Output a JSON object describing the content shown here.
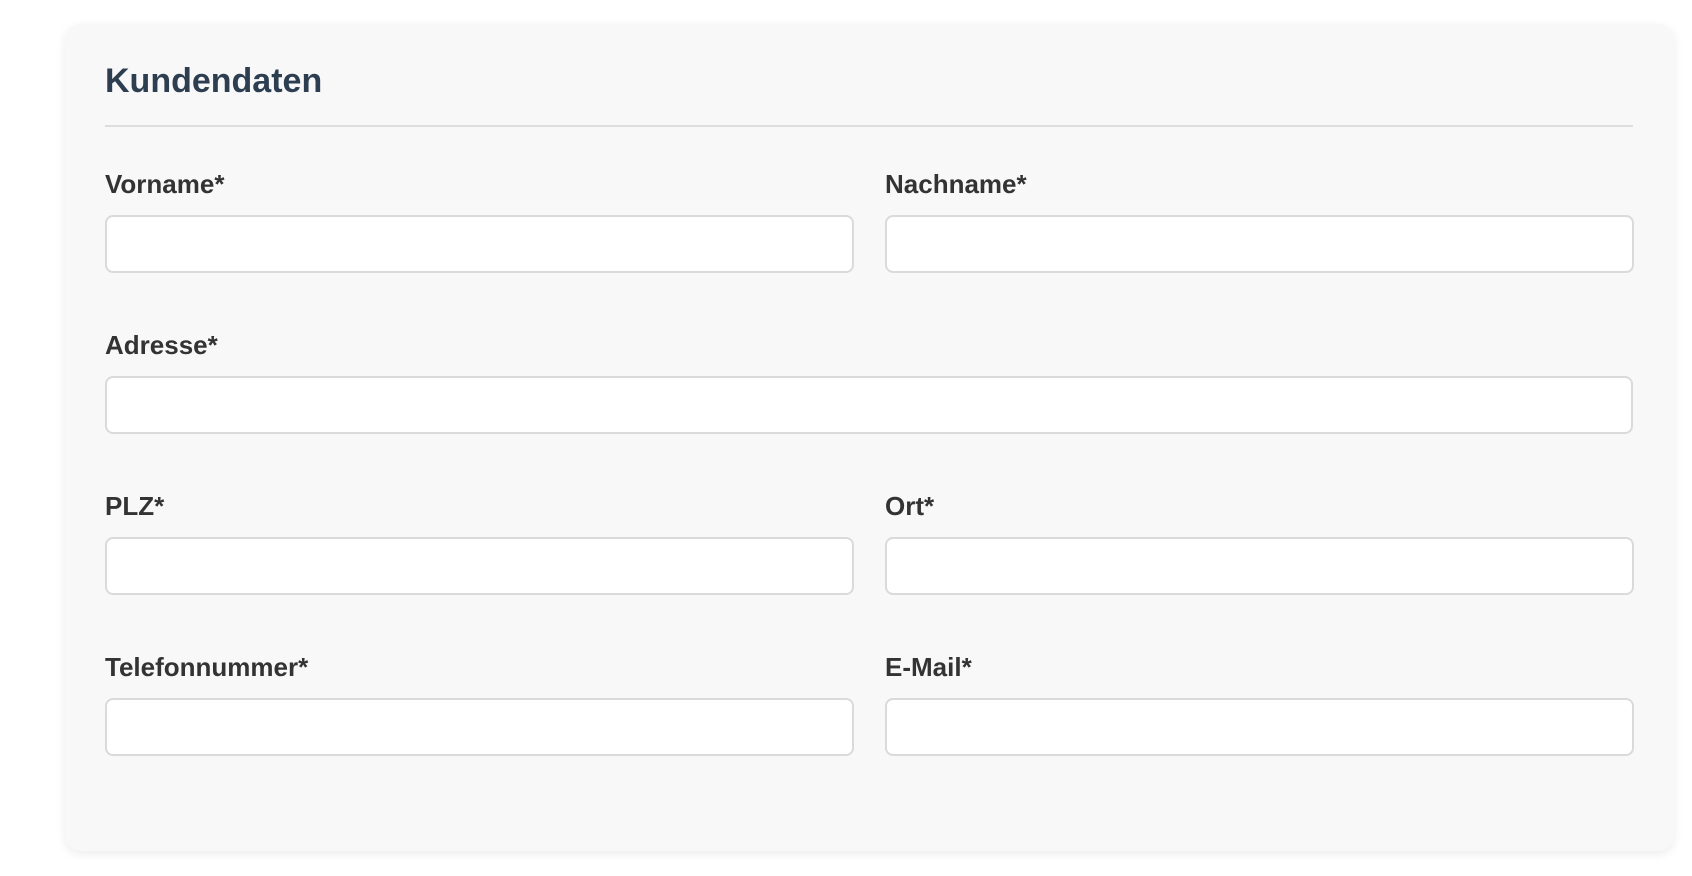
{
  "form": {
    "title": "Kundendaten",
    "fields": {
      "vorname": {
        "label": "Vorname*",
        "value": ""
      },
      "nachname": {
        "label": "Nachname*",
        "value": ""
      },
      "adresse": {
        "label": "Adresse*",
        "value": ""
      },
      "plz": {
        "label": "PLZ*",
        "value": ""
      },
      "ort": {
        "label": "Ort*",
        "value": ""
      },
      "telefon": {
        "label": "Telefonnummer*",
        "value": ""
      },
      "email": {
        "label": "E-Mail*",
        "value": ""
      }
    }
  }
}
